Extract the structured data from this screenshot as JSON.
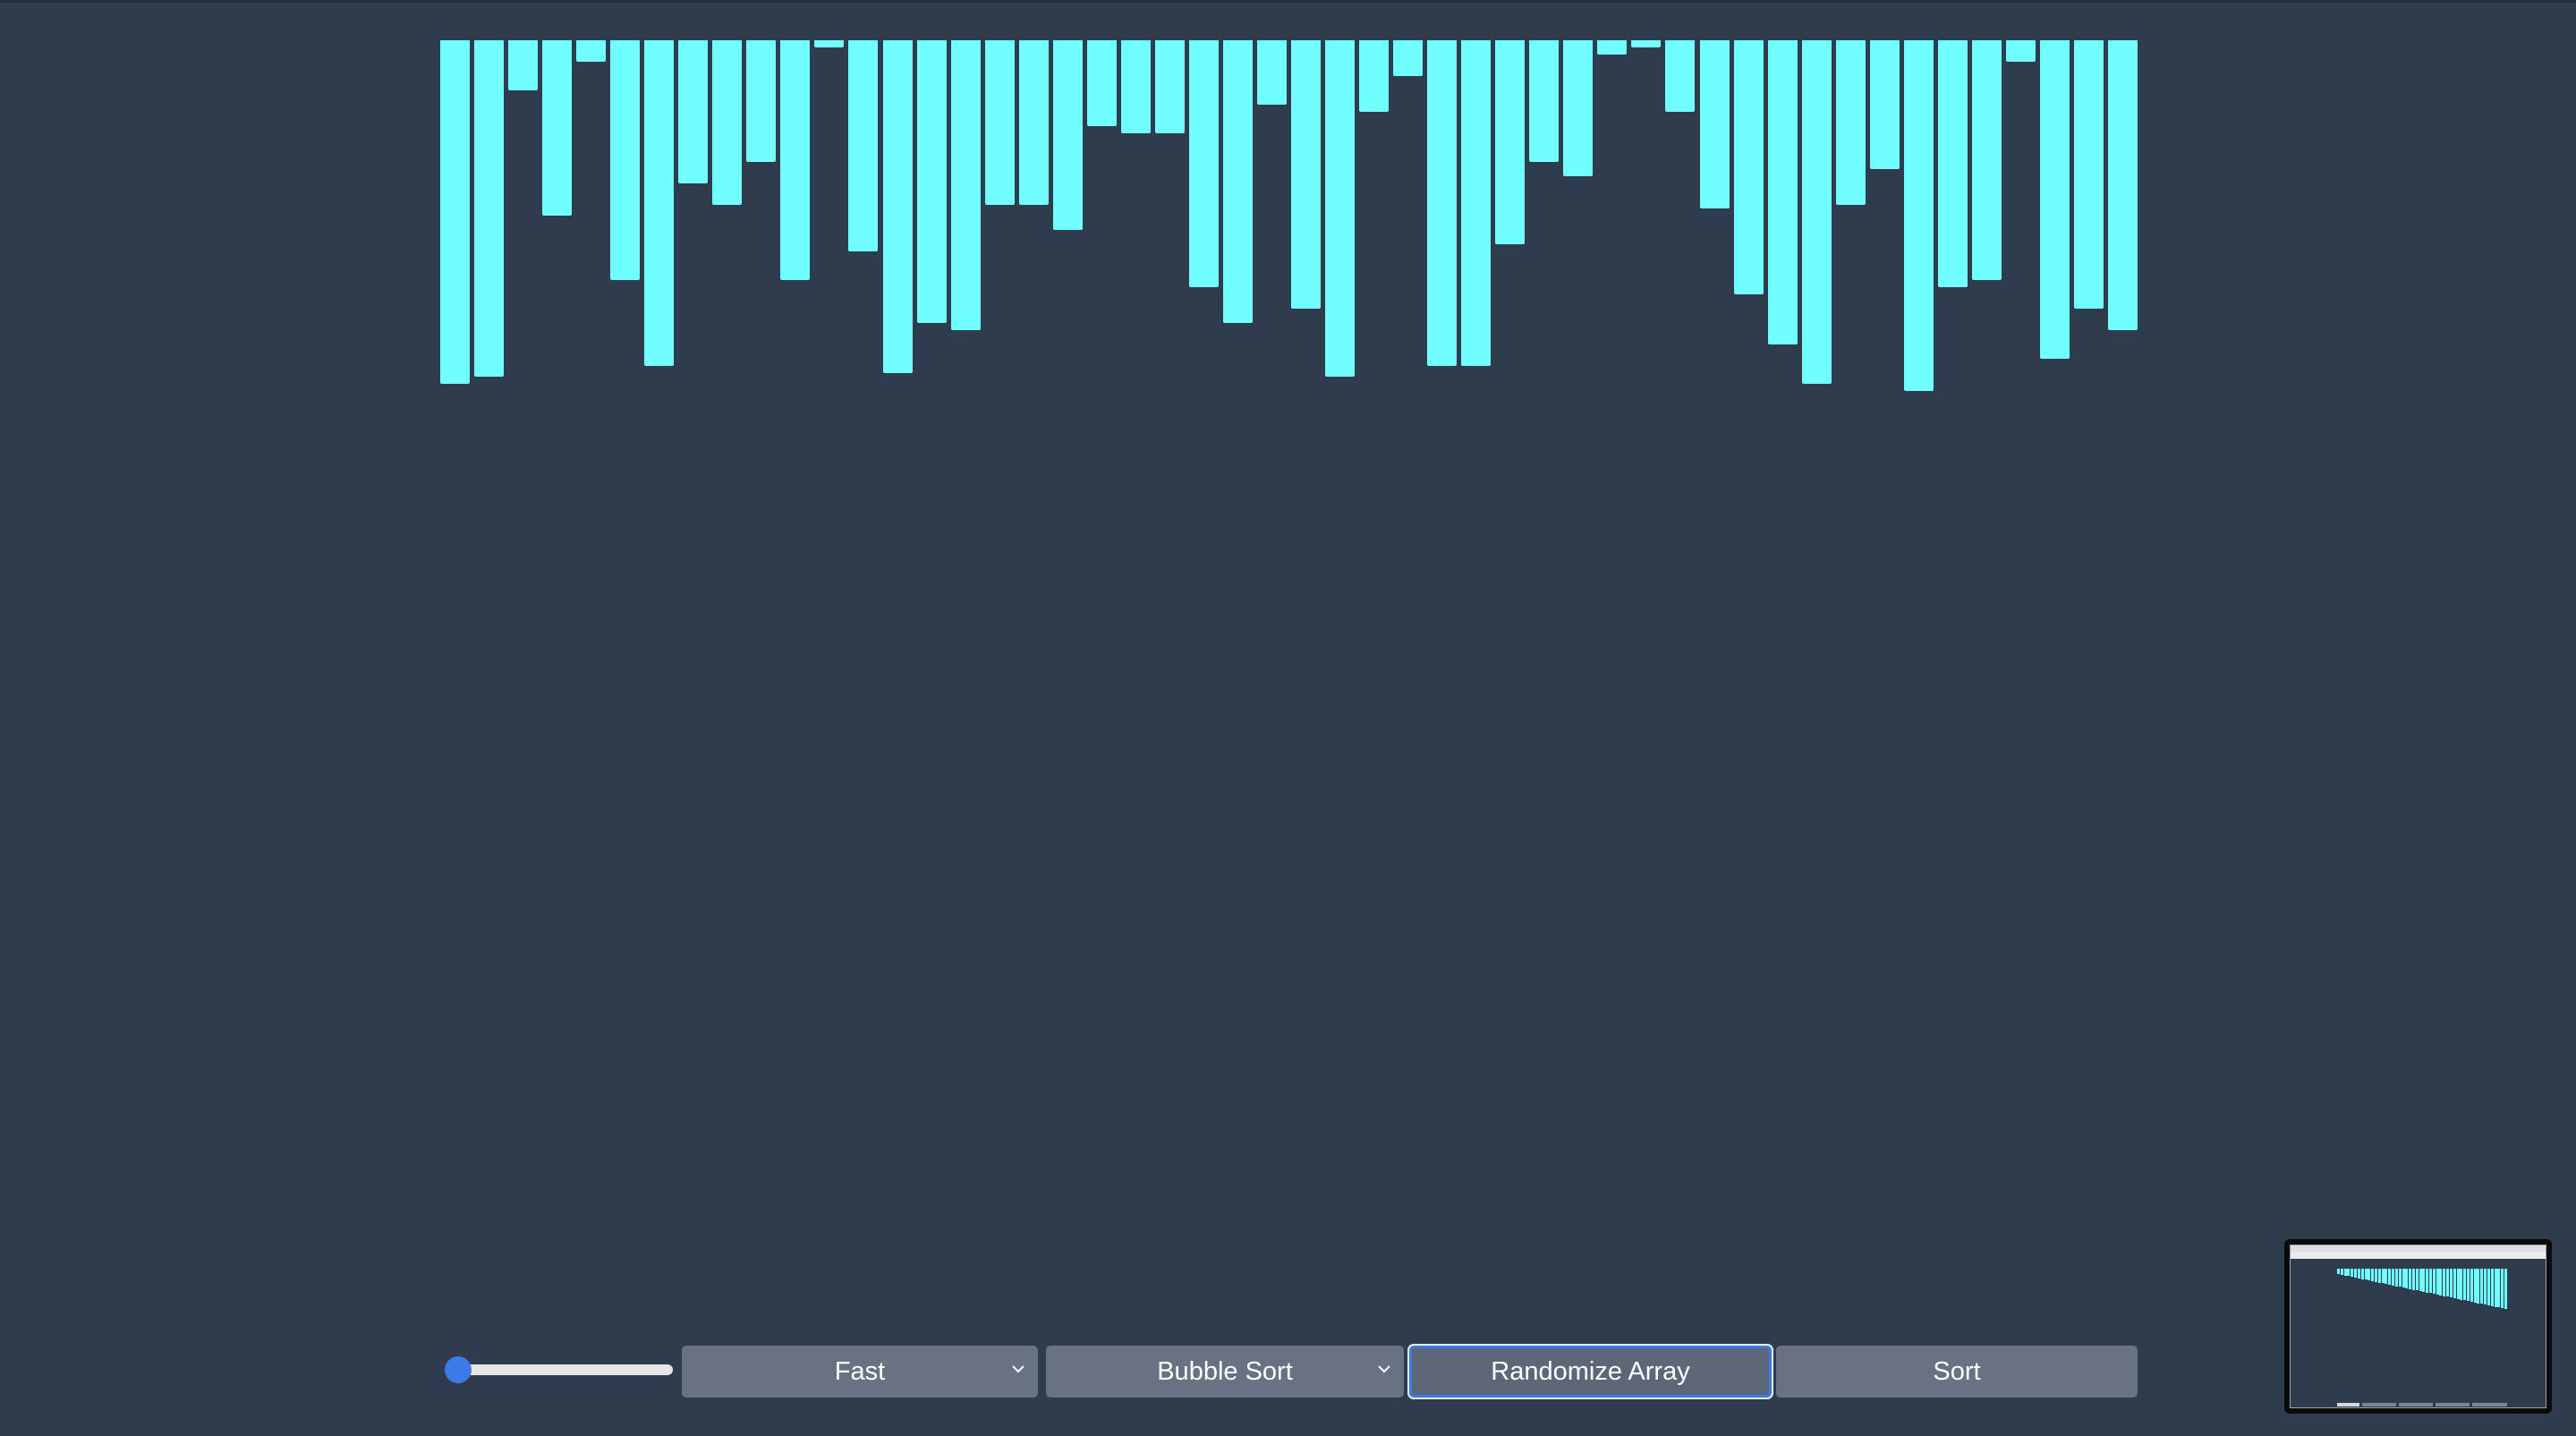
{
  "array": {
    "values": [
      96,
      94,
      14,
      49,
      6,
      67,
      91,
      40,
      46,
      34,
      67,
      2,
      59,
      93,
      79,
      81,
      46,
      46,
      53,
      24,
      26,
      26,
      69,
      79,
      18,
      75,
      94,
      20,
      10,
      91,
      91,
      57,
      34,
      38,
      4,
      2,
      20,
      47,
      71,
      85,
      96,
      46,
      36,
      98,
      69,
      67,
      6,
      89,
      75,
      81
    ],
    "max": 100,
    "bar_color": "#70feff"
  },
  "controls": {
    "size_slider": {
      "value": 0.0
    },
    "speed_select": {
      "value": "Fast"
    },
    "algorithm_select": {
      "value": "Bubble Sort"
    },
    "randomize_button": "Randomize Array",
    "sort_button": "Sort"
  },
  "colors": {
    "background": "#2f3c4e",
    "control_bg": "#687282",
    "accent": "#3b7be8",
    "text": "#ffffff"
  }
}
